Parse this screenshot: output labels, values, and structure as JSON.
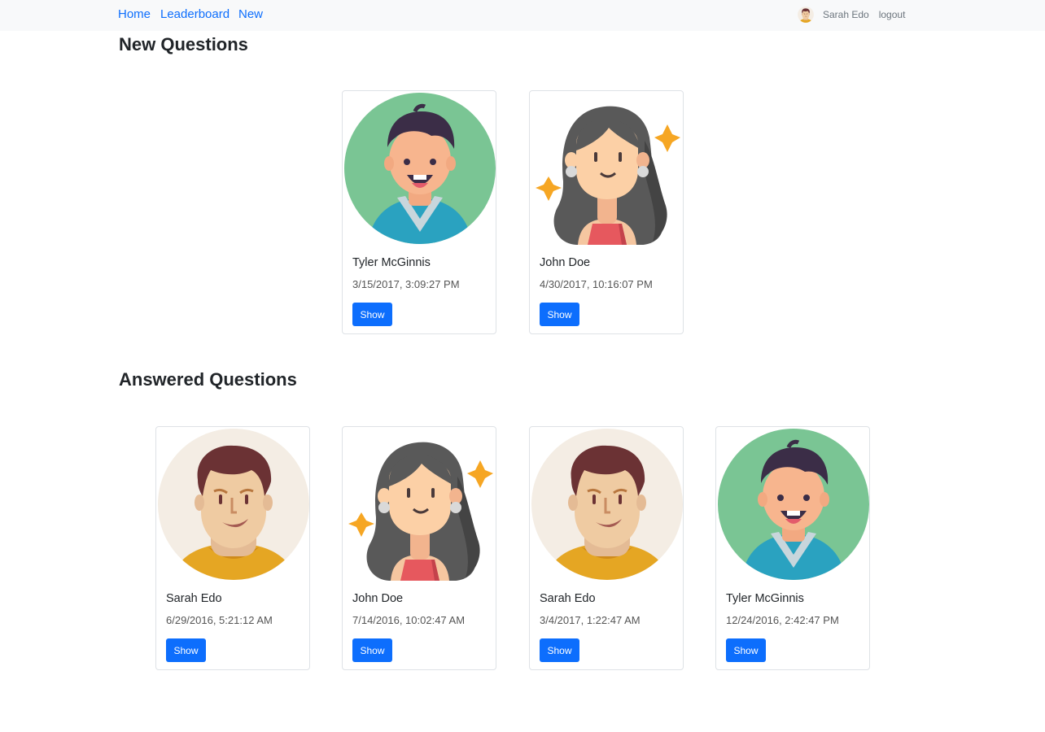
{
  "nav": {
    "links": [
      "Home",
      "Leaderboard",
      "New"
    ],
    "user_name": "Sarah Edo",
    "logout_label": "logout"
  },
  "new_section": {
    "title": "New Questions",
    "cards": [
      {
        "author": "Tyler McGinnis",
        "date": "3/15/2017, 3:09:27 PM",
        "button": "Show",
        "avatar_icon": "man-green-avatar"
      },
      {
        "author": "John Doe",
        "date": "4/30/2017, 10:16:07 PM",
        "button": "Show",
        "avatar_icon": "woman-avatar"
      }
    ]
  },
  "answered_section": {
    "title": "Answered Questions",
    "cards": [
      {
        "author": "Sarah Edo",
        "date": "6/29/2016, 5:21:12 AM",
        "button": "Show",
        "avatar_icon": "man-beige-avatar"
      },
      {
        "author": "John Doe",
        "date": "7/14/2016, 10:02:47 AM",
        "button": "Show",
        "avatar_icon": "woman-avatar"
      },
      {
        "author": "Sarah Edo",
        "date": "3/4/2017, 1:22:47 AM",
        "button": "Show",
        "avatar_icon": "man-beige-avatar"
      },
      {
        "author": "Tyler McGinnis",
        "date": "12/24/2016, 2:42:47 PM",
        "button": "Show",
        "avatar_icon": "man-green-avatar"
      }
    ]
  },
  "colors": {
    "primary": "#0d6efd",
    "navbar_bg": "#f8f9fa",
    "card_border": "#dee2e6"
  }
}
